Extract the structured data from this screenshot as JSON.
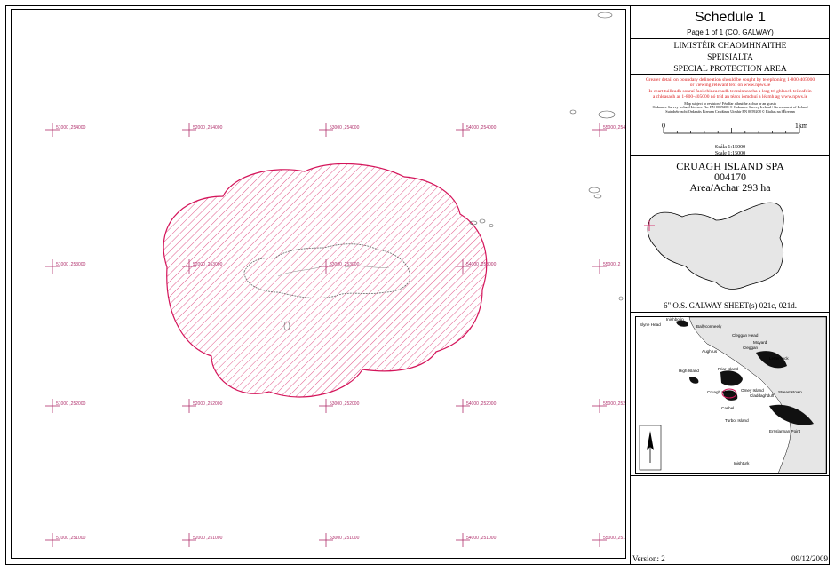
{
  "panel": {
    "schedule_title": "Schedule 1",
    "page_info": "Page 1 of 1 (CO. GALWAY)",
    "irish_lines": [
      "LIMISTÉIR CHAOMHNAITHE",
      "SPEISIALTA",
      "SPECIAL PROTECTION AREA"
    ],
    "red_notes": [
      "Greater detail on boundary delineation should be sought by telephoning 1-800-405000",
      "or viewing relevant text on www.npws.ie",
      "Is ceart tuilleadh sonraí faoi chineachadh teorainneacha a lorg trí ghlaoch teileafóin",
      "a chleasadh ar 1-800-405000 nó tríd an téacs iomchuí a léamh ag www.npws.ie"
    ],
    "fine_print": [
      "Map subject to revision / Féadfar athruithe a chur ar an gcasta",
      "Ordnance Survey Ireland Licence No. EN 0059208 © Ordnance Survey Ireland / Government of Ireland",
      "Suirbhéireacht Ordanáis Éireann Ceadúnas Uimhir EN 0059208 © Rialtas na hÉireann"
    ],
    "scale_start": "0",
    "scale_end": "1km",
    "scale_lines": [
      "Scála 1:15000",
      "Scale 1:15000"
    ],
    "spa_name": "CRUAGH ISLAND SPA",
    "spa_code": "004170",
    "spa_area": "Area/Achar 293 ha",
    "sheet": "6\" O.S.  GALWAY  SHEET(s) 021c, 021d.",
    "version": "Version: 2",
    "date": "09/12/2009"
  },
  "grid": {
    "rows": [
      [
        "51000 ,254000",
        "52000 ,254000",
        "53000 ,254000",
        "54000 ,254000",
        "55000 ,254000"
      ],
      [
        "51000 ,253000",
        "52000 ,253000",
        "53000 ,253000",
        "54000 ,253000",
        "55000 ,2"
      ],
      [
        "51000 ,252000",
        "52000 ,252000",
        "53000 ,252000",
        "54000 ,252000",
        "55000 ,252000"
      ],
      [
        "51000 ,251000",
        "52000 ,251000",
        "53000 ,251000",
        "54000 ,251000",
        "55000 ,251000"
      ]
    ]
  },
  "locator": {
    "places": [
      "Slyne Head",
      "Ballyconneely",
      "Cleggan",
      "Moyard",
      "Letterfrack",
      "Cleggan Head",
      "Inishbofin",
      "High Island",
      "Friar Island",
      "Omey Island",
      "Claddaghduff",
      "Cruagh Island",
      "Cashel",
      "Streamstown",
      "Turbot Island",
      "Errislannan Point",
      "Inishturk",
      "Aughrus"
    ]
  },
  "colors": {
    "boundary": "#d4145a",
    "grid": "#b0306c",
    "locator_land": "#e6e6e6"
  }
}
